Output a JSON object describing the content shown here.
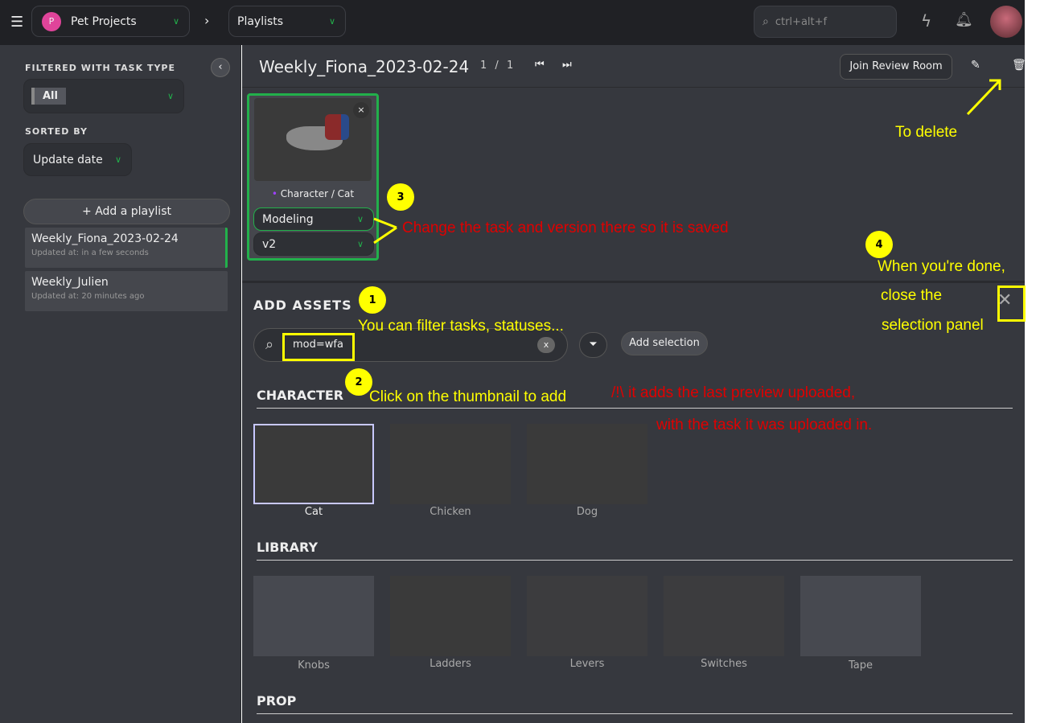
{
  "topbar": {
    "project": "Pet Projects",
    "project_initial": "P",
    "section": "Playlists",
    "search_placeholder": "ctrl+alt+f"
  },
  "sidebar": {
    "filter_label": "FILTERED WITH TASK TYPE",
    "filter_value": "All",
    "sort_label": "SORTED BY",
    "sort_value": "Update date",
    "add_playlist": "+ Add a playlist",
    "playlists": [
      {
        "name": "Weekly_Fiona_2023-02-24",
        "updated": "Updated at: in a few seconds",
        "selected": true
      },
      {
        "name": "Weekly_Julien",
        "updated": "Updated at: 20 minutes ago",
        "selected": false
      }
    ]
  },
  "playlist": {
    "title": "Weekly_Fiona_2023-02-24",
    "page": "1",
    "sep": "/",
    "total": "1",
    "join_review": "Join Review Room",
    "item": {
      "entity": "Character / Cat",
      "task": "Modeling",
      "version": "v2",
      "close": "×"
    }
  },
  "add_assets": {
    "title": "ADD ASSETS",
    "search_value": "mod=wfa",
    "clear": "x",
    "add_selection": "Add selection",
    "sections": [
      {
        "name": "CHARACTER",
        "assets": [
          "Cat",
          "Chicken",
          "Dog"
        ]
      },
      {
        "name": "LIBRARY",
        "assets": [
          "Knobs",
          "Ladders",
          "Levers",
          "Switches",
          "Tape"
        ]
      },
      {
        "name": "PROP",
        "assets": []
      }
    ]
  },
  "annotations": {
    "delete": "To delete",
    "n1": "1",
    "n2": "2",
    "n3": "3",
    "n4": "4",
    "filter": "You can filter tasks, statuses...",
    "click": "Click on the thumbnail to add",
    "change": "Change the task and version there so it is saved",
    "warn1": "/!\\ it adds the last preview uploaded,",
    "warn2": "with the task it was uploaded in.",
    "done1": "When you're done,",
    "done2": "close the",
    "done3": "selection panel"
  },
  "colors": {
    "accent": "#22b04b",
    "annotation_yellow": "#ffff00",
    "annotation_red": "#e00000",
    "avatar_pink": "#e0449a"
  }
}
